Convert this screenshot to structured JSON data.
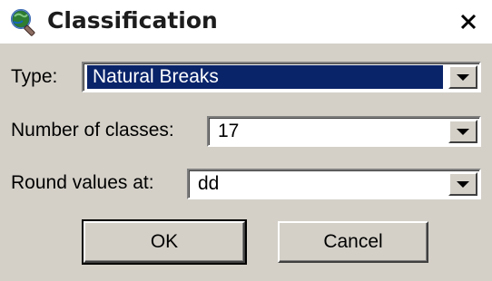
{
  "window": {
    "title": "Classification",
    "icon": "globe-magnifier-icon",
    "close_icon": "close-icon"
  },
  "fields": {
    "type": {
      "label": "Type:",
      "value": "Natural Breaks"
    },
    "classes": {
      "label": "Number of classes:",
      "value": "17"
    },
    "round": {
      "label": "Round values at:",
      "value": "dd"
    }
  },
  "buttons": {
    "ok": "OK",
    "cancel": "Cancel"
  },
  "colors": {
    "dialog_bg": "#d4d0c8",
    "selection": "#0a246a"
  }
}
